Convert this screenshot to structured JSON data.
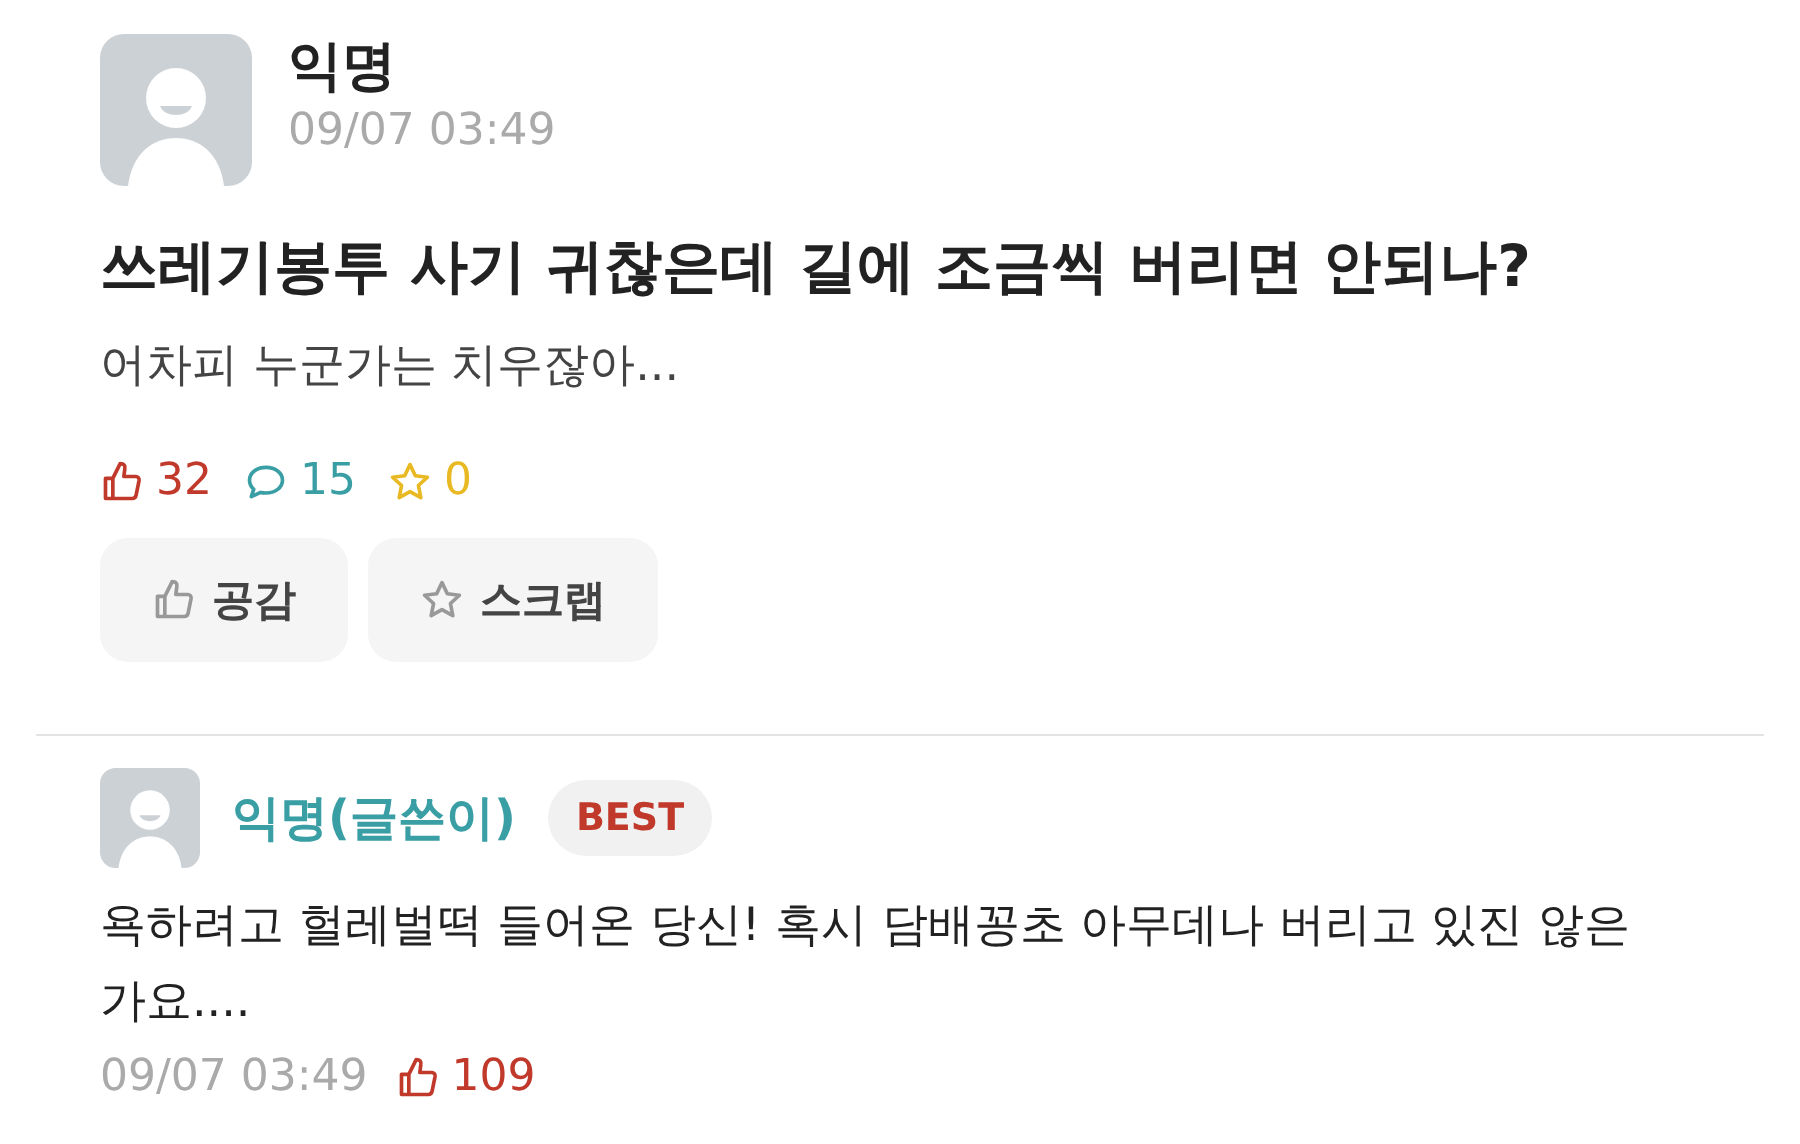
{
  "post": {
    "author": "익명",
    "time": "09/07 03:49",
    "title": "쓰레기봉투 사기 귀찮은데 길에 조금씩 버리면 안되나?",
    "body": "어차피 누군가는 치우잖아...",
    "stats": [
      {
        "kind": "like",
        "count": "32",
        "color": "#c0392b"
      },
      {
        "kind": "comment",
        "count": "15",
        "color": "#3a9ea5"
      },
      {
        "kind": "scrap",
        "count": "0",
        "color": "#e8b923"
      }
    ],
    "buttons": [
      {
        "kind": "like",
        "label": "공감"
      },
      {
        "kind": "scrap",
        "label": "스크랩"
      }
    ]
  },
  "comment": {
    "author": "익명(글쓴이)",
    "badge": "BEST",
    "text": "욕하려고 헐레벌떡 들어온 당신! 혹시 담배꽁초 아무데나 버리고 있진 않은가요....",
    "time": "09/07 03:49",
    "likes": "109"
  }
}
